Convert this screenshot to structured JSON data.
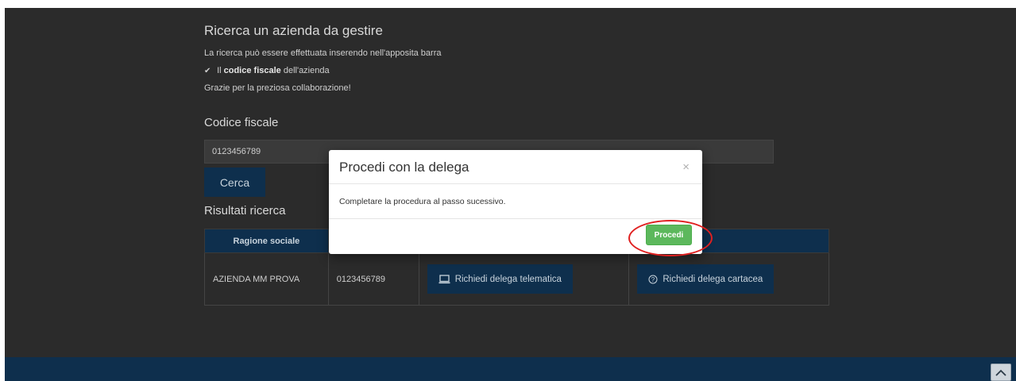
{
  "page": {
    "title": "Ricerca un azienda da gestire",
    "instruction": "La ricerca può essere effettuata inserendo nell'apposita barra",
    "criteria_prefix": "Il",
    "criteria_bold": "codice fiscale",
    "criteria_suffix": "dell'azienda",
    "thanks": "Grazie per la preziosa collaborazione!"
  },
  "search": {
    "label": "Codice fiscale",
    "value": "0123456789",
    "button_label": "Cerca"
  },
  "results": {
    "label": "Risultati ricerca",
    "headers": [
      "Ragione sociale",
      "",
      "",
      ""
    ],
    "rows": [
      {
        "ragione_sociale": "AZIENDA MM PROVA",
        "codice_fiscale": "0123456789",
        "telematica_label": "Richiedi delega telematica",
        "cartacea_label": "Richiedi delega cartacea"
      }
    ]
  },
  "modal": {
    "title": "Procedi con la delega",
    "close_glyph": "×",
    "body": "Completare la procedura al passo sucessivo.",
    "confirm_label": "Procedi"
  },
  "icons": {
    "check": "check-icon",
    "laptop": "laptop-icon",
    "help": "question-circle-icon",
    "scroll_top": "chevron-up-icon"
  },
  "colors": {
    "brand_navy": "#0e2f4d",
    "background": "#2b2b2b",
    "confirm_green": "#5cb85c",
    "highlight_red": "#e02020"
  }
}
